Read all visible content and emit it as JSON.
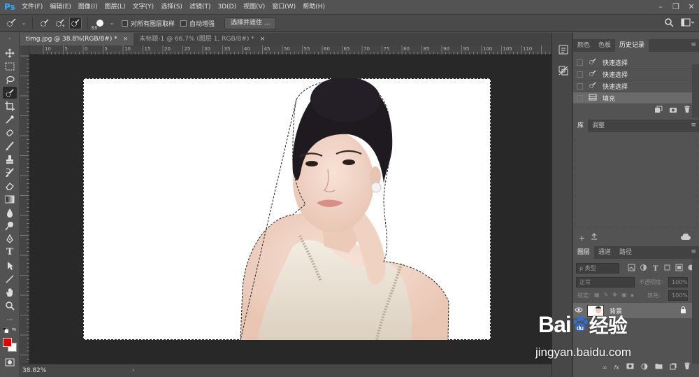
{
  "app": {
    "logo": "Ps"
  },
  "menubar": {
    "items": [
      "文件(F)",
      "编辑(E)",
      "图像(I)",
      "图层(L)",
      "文字(Y)",
      "选择(S)",
      "滤镜(T)",
      "3D(D)",
      "视图(V)",
      "窗口(W)",
      "帮助(H)"
    ]
  },
  "window_controls": {
    "minimize": "–",
    "restore": "❐",
    "close": "✕"
  },
  "options": {
    "brush_size": "33",
    "sample_all_layers": "对所有图层取样",
    "auto_enhance": "自动增强",
    "refine_button": "选择并遮住 ..."
  },
  "doc_tabs": [
    {
      "label": "timg.jpg @ 38.8%(RGB/8#) *",
      "close": "×"
    },
    {
      "label": "未标题-1 @ 66.7% (图层 1, RGB/8#) *",
      "close": "×"
    }
  ],
  "ruler_ticks": [
    "10",
    "5",
    "0",
    "5",
    "10",
    "15",
    "20",
    "25",
    "30",
    "35",
    "40",
    "45",
    "50",
    "55",
    "60",
    "65",
    "70",
    "75",
    "80",
    "85",
    "90",
    "95",
    "100",
    "105",
    "110"
  ],
  "status": {
    "zoom": "38.82%",
    "arrow": "›"
  },
  "panels": {
    "top_tabs": [
      "颜色",
      "色板",
      "历史记录"
    ],
    "history": [
      {
        "label": "快速选择"
      },
      {
        "label": "快速选择"
      },
      {
        "label": "快速选择"
      },
      {
        "label": "填充"
      }
    ],
    "library_tabs": [
      "库",
      "调整"
    ],
    "layers_tabs": [
      "图层",
      "通道",
      "路径"
    ],
    "layers": {
      "filter_placeholder": "ρ 类型",
      "blend_mode": "正常",
      "opacity_label": "不透明度:",
      "opacity_value": "100%",
      "lock_label": "锁定:",
      "fill_label": "填充:",
      "fill_value": "100%",
      "layer_name": "背景"
    }
  },
  "watermark": {
    "main": "Bai",
    "paw": "du",
    "suffix": "经验",
    "url": "jingyan.baidu.com"
  }
}
